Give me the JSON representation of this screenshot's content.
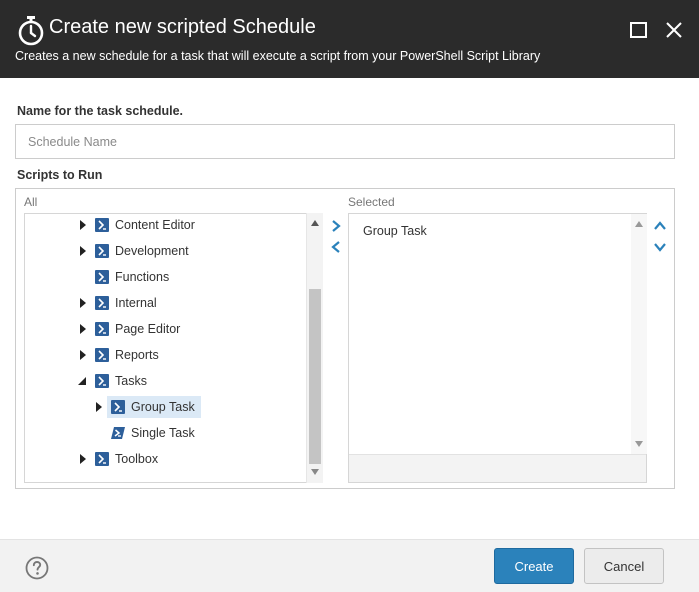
{
  "dialog": {
    "title": "Create new scripted Schedule",
    "subtitle": "Creates a new schedule for a task that will execute a script from your PowerShell Script Library",
    "title_icon": "stopwatch-icon",
    "maximize_icon": "maximize-icon",
    "close_icon": "close-icon"
  },
  "name_field": {
    "label": "Name for the task schedule.",
    "placeholder": "Schedule Name",
    "value": ""
  },
  "scripts": {
    "label": "Scripts to Run",
    "all_label": "All",
    "selected_label": "Selected",
    "tree": [
      {
        "label": "Content Editor",
        "expander": "collapsed"
      },
      {
        "label": "Development",
        "expander": "collapsed"
      },
      {
        "label": "Functions",
        "expander": "none"
      },
      {
        "label": "Internal",
        "expander": "collapsed"
      },
      {
        "label": "Page Editor",
        "expander": "collapsed"
      },
      {
        "label": "Reports",
        "expander": "collapsed"
      },
      {
        "label": "Tasks",
        "expander": "expanded"
      },
      {
        "label": "Group Task",
        "expander": "collapsed",
        "selected": true
      },
      {
        "label": "Single Task",
        "expander": "none"
      },
      {
        "label": "Toolbox",
        "expander": "collapsed"
      }
    ],
    "selected_items": [
      "Group Task"
    ]
  },
  "footer": {
    "help_icon": "help-icon",
    "create_label": "Create",
    "cancel_label": "Cancel"
  },
  "colors": {
    "titlebar": "#2b2b2b",
    "accent": "#2b82bb",
    "selection": "#dbe9f6",
    "powershell_icon": "#2d5f9a"
  }
}
